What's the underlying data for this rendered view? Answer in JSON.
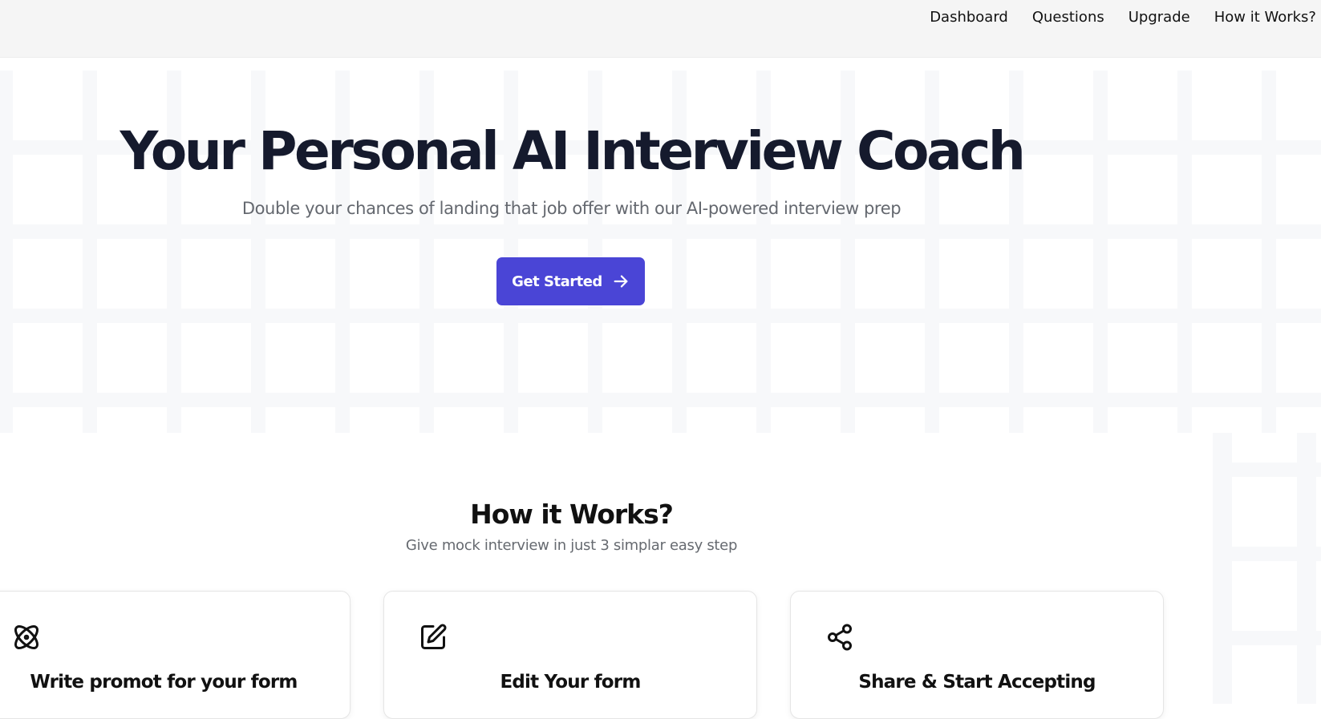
{
  "nav": {
    "items": [
      {
        "label": "Dashboard"
      },
      {
        "label": "Questions"
      },
      {
        "label": "Upgrade"
      },
      {
        "label": "How it Works?"
      }
    ]
  },
  "hero": {
    "title": "Your Personal AI Interview Coach",
    "subtitle": "Double your chances of landing that job offer with our AI-powered interview prep",
    "cta_label": "Get Started",
    "cta_icon": "arrow-right-icon",
    "accent_color": "#4a45d6"
  },
  "how_it_works": {
    "title": "How it Works?",
    "subtitle": "Give mock interview in just 3 simplar easy step",
    "cards": [
      {
        "title": "Write promot for your form",
        "icon": "atom-icon"
      },
      {
        "title": "Edit Your form",
        "icon": "edit-icon"
      },
      {
        "title": "Share & Start Accepting",
        "icon": "share-icon"
      }
    ]
  }
}
